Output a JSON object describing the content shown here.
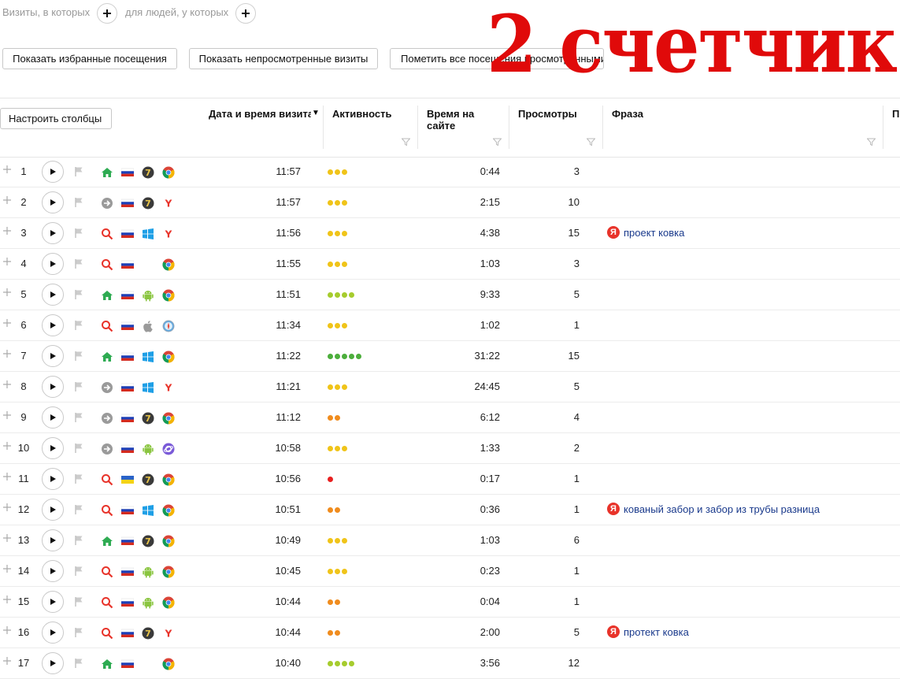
{
  "watermark": "2 счетчик",
  "filters": {
    "visits_label": "Визиты, в которых",
    "people_label": "для людей, у которых"
  },
  "toolbar": {
    "show_favorites": "Показать избранные посещения",
    "show_unviewed": "Показать непросмотренные визиты",
    "mark_all": "Пометить все посещения просмотренными",
    "configure_columns": "Настроить столбцы"
  },
  "columns": {
    "datetime": "Дата и время визита",
    "activity": "Активность",
    "time_on_site_1": "Время на",
    "time_on_site_2": "сайте",
    "views": "Просмотры",
    "phrase": "Фраза",
    "next_partial": "П"
  },
  "colors": {
    "activity_1": "#e82020",
    "activity_2": "#f08c1e",
    "activity_3": "#f0c419",
    "activity_4": "#a6cc2e",
    "activity_5": "#4cae3c",
    "yandex_red": "#e8332a",
    "phrase_link": "#1a3a8c"
  },
  "rows": [
    {
      "n": "1",
      "source": "home-icon",
      "country": "flag-ru-icon",
      "os": "windows7-icon",
      "browser": "chrome-icon",
      "time": "11:57",
      "activity": 3,
      "duration": "0:44",
      "views": "3",
      "phrase": ""
    },
    {
      "n": "2",
      "source": "arrow-right-icon",
      "country": "flag-ru-icon",
      "os": "windows7-icon",
      "browser": "yandex-browser-icon",
      "time": "11:57",
      "activity": 3,
      "duration": "2:15",
      "views": "10",
      "phrase": ""
    },
    {
      "n": "3",
      "source": "search-icon",
      "country": "flag-ru-icon",
      "os": "windows-icon",
      "browser": "yandex-browser-icon",
      "time": "11:56",
      "activity": 3,
      "duration": "4:38",
      "views": "15",
      "phrase": "проект ковка"
    },
    {
      "n": "4",
      "source": "search-icon",
      "country": "flag-ru-icon",
      "os": "",
      "browser": "chrome-icon",
      "time": "11:55",
      "activity": 3,
      "duration": "1:03",
      "views": "3",
      "phrase": ""
    },
    {
      "n": "5",
      "source": "home-icon",
      "country": "flag-ru-icon",
      "os": "android-icon",
      "browser": "chrome-icon",
      "time": "11:51",
      "activity": 4,
      "duration": "9:33",
      "views": "5",
      "phrase": ""
    },
    {
      "n": "6",
      "source": "search-icon",
      "country": "flag-ru-icon",
      "os": "apple-icon",
      "browser": "safari-icon",
      "time": "11:34",
      "activity": 3,
      "duration": "1:02",
      "views": "1",
      "phrase": ""
    },
    {
      "n": "7",
      "source": "home-icon",
      "country": "flag-ru-icon",
      "os": "windows-icon",
      "browser": "chrome-icon",
      "time": "11:22",
      "activity": 5,
      "duration": "31:22",
      "views": "15",
      "phrase": ""
    },
    {
      "n": "8",
      "source": "arrow-right-icon",
      "country": "flag-ru-icon",
      "os": "windows-icon",
      "browser": "yandex-browser-icon",
      "time": "11:21",
      "activity": 3,
      "duration": "24:45",
      "views": "5",
      "phrase": ""
    },
    {
      "n": "9",
      "source": "arrow-right-icon",
      "country": "flag-ru-icon",
      "os": "windows7-icon",
      "browser": "chrome-icon",
      "time": "11:12",
      "activity": 2,
      "duration": "6:12",
      "views": "4",
      "phrase": ""
    },
    {
      "n": "10",
      "source": "arrow-right-icon",
      "country": "flag-ru-icon",
      "os": "android-icon",
      "browser": "samsung-browser-icon",
      "time": "10:58",
      "activity": 3,
      "duration": "1:33",
      "views": "2",
      "phrase": ""
    },
    {
      "n": "11",
      "source": "search-icon",
      "country": "flag-ua-icon",
      "os": "windows7-icon",
      "browser": "chrome-icon",
      "time": "10:56",
      "activity": 1,
      "duration": "0:17",
      "views": "1",
      "phrase": ""
    },
    {
      "n": "12",
      "source": "search-icon",
      "country": "flag-ru-icon",
      "os": "windows-icon",
      "browser": "chrome-icon",
      "time": "10:51",
      "activity": 2,
      "duration": "0:36",
      "views": "1",
      "phrase": "кованый забор и забор из трубы разница"
    },
    {
      "n": "13",
      "source": "home-icon",
      "country": "flag-ru-icon",
      "os": "windows7-icon",
      "browser": "chrome-icon",
      "time": "10:49",
      "activity": 3,
      "duration": "1:03",
      "views": "6",
      "phrase": ""
    },
    {
      "n": "14",
      "source": "search-icon",
      "country": "flag-ru-icon",
      "os": "android-icon",
      "browser": "chrome-icon",
      "time": "10:45",
      "activity": 3,
      "duration": "0:23",
      "views": "1",
      "phrase": ""
    },
    {
      "n": "15",
      "source": "search-icon",
      "country": "flag-ru-icon",
      "os": "android-icon",
      "browser": "chrome-icon",
      "time": "10:44",
      "activity": 2,
      "duration": "0:04",
      "views": "1",
      "phrase": ""
    },
    {
      "n": "16",
      "source": "search-icon",
      "country": "flag-ru-icon",
      "os": "windows7-icon",
      "browser": "yandex-browser-icon",
      "time": "10:44",
      "activity": 2,
      "duration": "2:00",
      "views": "5",
      "phrase": "протект ковка"
    },
    {
      "n": "17",
      "source": "home-icon",
      "country": "flag-ru-icon",
      "os": "",
      "browser": "chrome-icon",
      "time": "10:40",
      "activity": 4,
      "duration": "3:56",
      "views": "12",
      "phrase": ""
    }
  ]
}
